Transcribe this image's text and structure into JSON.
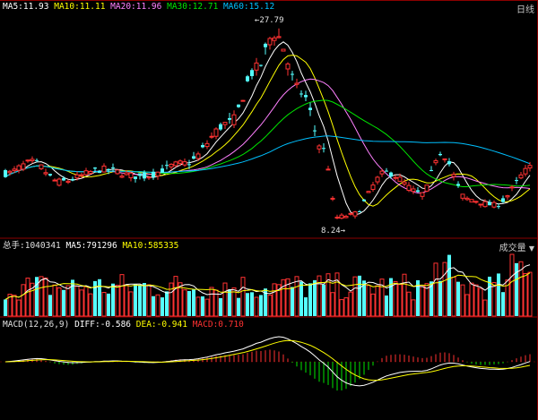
{
  "price_header": {
    "ma5": "MA5:11.93",
    "ma10": "MA10:11.11",
    "ma20": "MA20:11.96",
    "ma30": "MA30:12.71",
    "ma60": "MA60:15.12",
    "period_button": "日线"
  },
  "volume_header": {
    "total": "总手:1040341",
    "ma5": "MA5:791296",
    "ma10": "MA10:585335",
    "type_button": "成交量"
  },
  "macd_header": {
    "name": "MACD(12,26,9)",
    "diff": "DIFF:-0.586",
    "dea": "DEA:-0.941",
    "macd": "MACD:0.710"
  },
  "annotations": {
    "high": "27.79",
    "low": "8.24",
    "high_arrow": "←",
    "low_arrow": "→"
  },
  "colors": {
    "up": "#ff3232",
    "down": "#54ffff",
    "ma5": "#ffffff",
    "ma10": "#ffff00",
    "ma20": "#ff80ff",
    "ma30": "#00e600",
    "ma60": "#00c0ff",
    "macd_up": "#ff3232",
    "macd_down": "#00e600",
    "grid": "#8b0000"
  }
}
